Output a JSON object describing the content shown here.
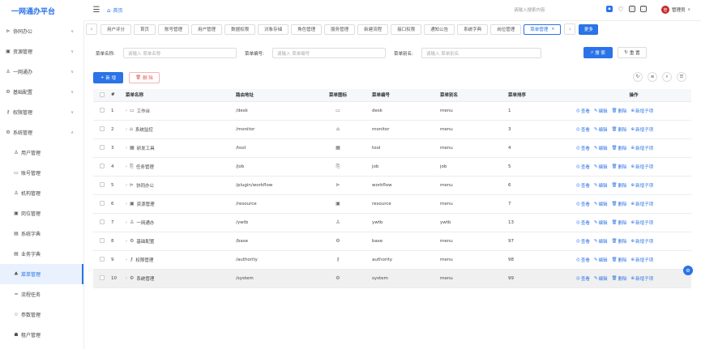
{
  "app": {
    "title": "一网通办平台"
  },
  "header": {
    "home_label": "首页",
    "search_placeholder": "请输入搜索内容",
    "user_name": "管理员",
    "avatar_text": "管"
  },
  "sidebar": {
    "items": [
      {
        "label": "协同办公",
        "icon": "send-icon",
        "glyph": "⊳",
        "caret": "∨"
      },
      {
        "label": "资源管理",
        "icon": "folder-icon",
        "glyph": "▣",
        "caret": "∨"
      },
      {
        "label": "一网通办",
        "icon": "people-icon",
        "glyph": "♙",
        "caret": "∨"
      },
      {
        "label": "基础配置",
        "icon": "cog-box-icon",
        "glyph": "⚙",
        "caret": "∨"
      },
      {
        "label": "权限管理",
        "icon": "key-icon",
        "glyph": "⚷",
        "caret": "∨"
      },
      {
        "label": "系统管理",
        "icon": "gear-icon",
        "glyph": "⚙",
        "caret": "∧"
      }
    ],
    "sub_items": [
      {
        "label": "用户管理",
        "icon": "user-icon",
        "glyph": "♙"
      },
      {
        "label": "账号管理",
        "icon": "id-card-icon",
        "glyph": "▭"
      },
      {
        "label": "机构管理",
        "icon": "org-icon",
        "glyph": "♙"
      },
      {
        "label": "岗位管理",
        "icon": "post-icon",
        "glyph": "▣"
      },
      {
        "label": "系统字典",
        "icon": "book-icon",
        "glyph": "▤"
      },
      {
        "label": "业务字典",
        "icon": "book-icon",
        "glyph": "▤"
      },
      {
        "label": "菜单管理",
        "icon": "tree-icon",
        "glyph": "♣",
        "active": true
      },
      {
        "label": "流程任务",
        "icon": "flow-icon",
        "glyph": "≈"
      },
      {
        "label": "参数管理",
        "icon": "star-icon",
        "glyph": "☆"
      },
      {
        "label": "租户管理",
        "icon": "tenant-icon",
        "glyph": "☗"
      },
      {
        "label": "应用管理",
        "icon": "app-icon",
        "glyph": "▯"
      }
    ]
  },
  "tabs": {
    "items": [
      "用户评分",
      "首页",
      "账号管理",
      "用户管理",
      "数据权限",
      "对象存储",
      "角色管理",
      "服务管理",
      "新建流程",
      "接口权限",
      "通知公告",
      "系统字典",
      "岗位管理",
      "菜单管理"
    ],
    "active_index": 13,
    "more_label": "更多"
  },
  "filter": {
    "name_label": "菜单名称:",
    "name_placeholder": "请输入 菜单名称",
    "code_label": "菜单编号:",
    "code_placeholder": "请输入 菜单编号",
    "alias_label": "菜单别名:",
    "alias_placeholder": "请输入 菜单别名",
    "search_label": "搜 索",
    "reset_label": "重 置"
  },
  "toolbar": {
    "add_label": "新 增",
    "delete_label": "删 除"
  },
  "table": {
    "columns": [
      "",
      "#",
      "菜单名称",
      "路由地址",
      "菜单图标",
      "菜单编号",
      "菜单别名",
      "菜单排序",
      "操作"
    ],
    "ops": [
      "查看",
      "编辑",
      "删除",
      "新增子项"
    ],
    "rows": [
      {
        "index": "1",
        "name": "工作台",
        "icon": "monitor-icon",
        "glyph": "▭",
        "path": "/desk",
        "code": "desk",
        "alias": "menu",
        "sort": "1"
      },
      {
        "index": "2",
        "name": "系统监控",
        "icon": "bank-icon",
        "glyph": "⌂",
        "path": "/monitor",
        "code": "monitor",
        "alias": "menu",
        "sort": "3"
      },
      {
        "index": "3",
        "name": "研发工具",
        "icon": "calendar-icon",
        "glyph": "▦",
        "path": "/tool",
        "code": "tool",
        "alias": "menu",
        "sort": "4"
      },
      {
        "index": "4",
        "name": "任务管理",
        "icon": "task-icon",
        "glyph": "⎘",
        "path": "/job",
        "code": "job",
        "alias": "job",
        "sort": "5"
      },
      {
        "index": "5",
        "name": "协同办公",
        "icon": "send-icon",
        "glyph": "⊳",
        "path": "/plugin/workflow",
        "code": "workflow",
        "alias": "menu",
        "sort": "6"
      },
      {
        "index": "6",
        "name": "资源管理",
        "icon": "folder-icon",
        "glyph": "▣",
        "path": "/resource",
        "code": "resource",
        "alias": "menu",
        "sort": "7"
      },
      {
        "index": "7",
        "name": "一网通办",
        "icon": "people-icon",
        "glyph": "♙",
        "path": "/ywtb",
        "code": "ywtb",
        "alias": "ywtb",
        "sort": "13"
      },
      {
        "index": "8",
        "name": "基础配置",
        "icon": "cog-box-icon",
        "glyph": "⚙",
        "path": "/base",
        "code": "base",
        "alias": "menu",
        "sort": "97"
      },
      {
        "index": "9",
        "name": "权限管理",
        "icon": "key-icon",
        "glyph": "⚷",
        "path": "/authority",
        "code": "authority",
        "alias": "menu",
        "sort": "98"
      },
      {
        "index": "10",
        "name": "系统管理",
        "icon": "gear-icon",
        "glyph": "⚙",
        "path": "/system",
        "code": "system",
        "alias": "menu",
        "sort": "99"
      }
    ]
  },
  "colors": {
    "accent": "#2a73e8",
    "danger": "#e05555",
    "avatar": "#c62828"
  }
}
